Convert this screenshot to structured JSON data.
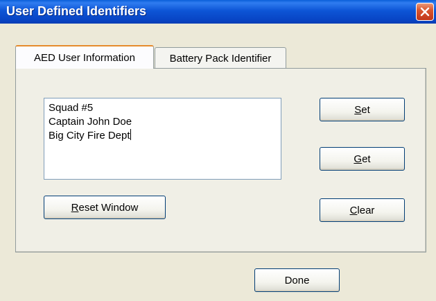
{
  "window": {
    "title": "User Defined Identifiers"
  },
  "tabs": [
    {
      "label": "AED User Information",
      "active": true
    },
    {
      "label": "Battery Pack Identifier",
      "active": false
    }
  ],
  "textbox": {
    "lines": [
      "Squad #5",
      "Captain John Doe",
      "Big City Fire Dept"
    ]
  },
  "buttons": {
    "set": {
      "mnemonic": "S",
      "rest": "et"
    },
    "get": {
      "mnemonic": "G",
      "rest": "et"
    },
    "clear": {
      "mnemonic": "C",
      "rest": "lear"
    },
    "reset": {
      "mnemonic": "R",
      "rest": "eset Window"
    },
    "done": {
      "label": "Done"
    }
  },
  "colors": {
    "titlebar": "#0a5fd8",
    "close_button": "#d9552e",
    "dialog_bg": "#ece9d8",
    "active_tab_accent": "#e68b2c"
  },
  "icons": {
    "close": "close-icon"
  }
}
